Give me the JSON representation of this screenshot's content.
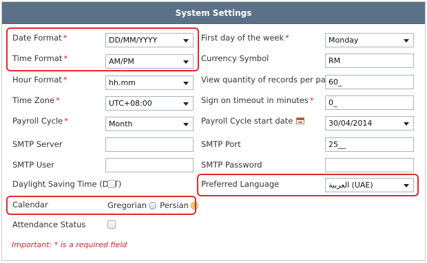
{
  "title": "System Settings",
  "left": {
    "date_format": {
      "label": "Date Format",
      "value": "DD/MM/YYYY"
    },
    "time_format": {
      "label": "Time Format",
      "value": "AM/PM"
    },
    "hour_format": {
      "label": "Hour Format",
      "value": "hh.mm"
    },
    "time_zone": {
      "label": "Time Zone",
      "value": "UTC+08:00"
    },
    "payroll_cycle": {
      "label": "Payroll Cycle",
      "value": "Month"
    },
    "smtp_server": {
      "label": "SMTP Server",
      "value": ""
    },
    "smtp_user": {
      "label": "SMTP User",
      "value": ""
    },
    "dst": {
      "label": "Daylight Saving Time (DST)",
      "checked": false
    },
    "calendar": {
      "label": "Calendar",
      "option1": "Gregorian",
      "option2": "Persian",
      "selected": "Persian"
    },
    "attendance": {
      "label": "Attendance Status",
      "checked": false
    }
  },
  "right": {
    "first_day": {
      "label": "First day of the week",
      "value": "Monday"
    },
    "currency": {
      "label": "Currency Symbol",
      "value": "RM"
    },
    "view_qty": {
      "label": "View quantity of records per page",
      "value": "60_"
    },
    "sign_on": {
      "label": "Sign on timeout in minutes",
      "value": "0_"
    },
    "payroll_start": {
      "label": "Payroll Cycle start date",
      "value": "30/04/2014"
    },
    "smtp_port": {
      "label": "SMTP Port",
      "value": "25__"
    },
    "smtp_password": {
      "label": "SMTP Password",
      "value": ""
    },
    "language": {
      "label": "Preferred Language",
      "value": "العربية (UAE)"
    }
  },
  "required_mark": "*",
  "footnote": "Important: * is a required field",
  "colors": {
    "header": "#5a7187",
    "required": "#e0202a",
    "highlight": "#e3262c"
  }
}
